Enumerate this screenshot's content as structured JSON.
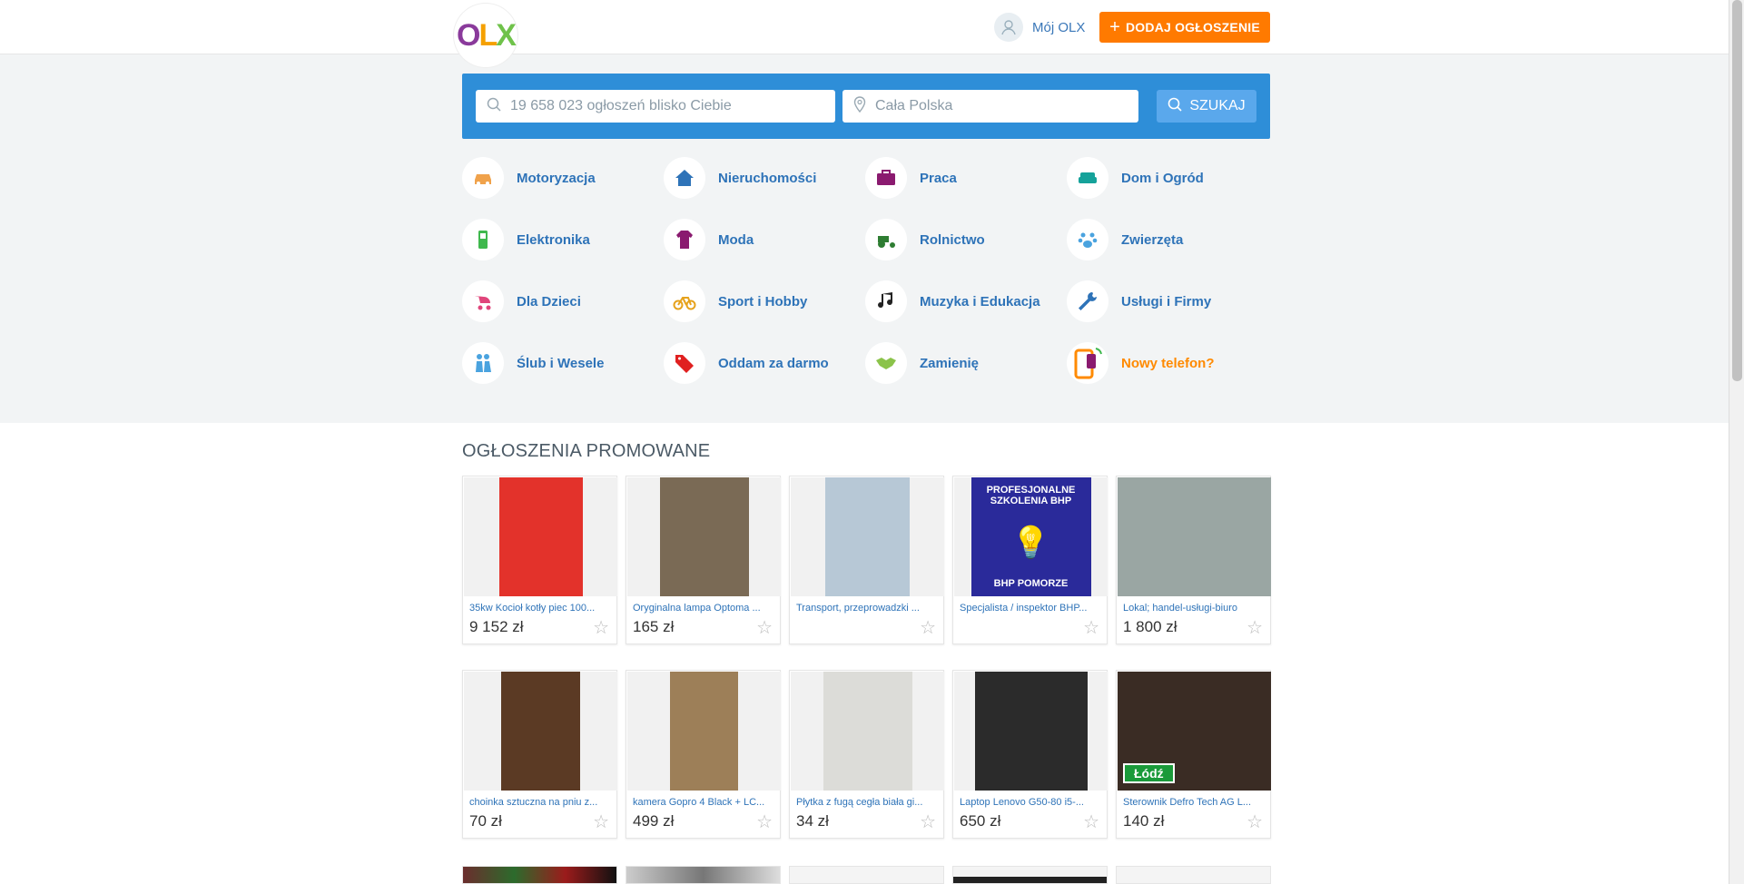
{
  "header": {
    "logo_letters": [
      "O",
      "L",
      "X"
    ],
    "my_olx": "Mój OLX",
    "add_ad": "DODAJ OGŁOSZENIE"
  },
  "search": {
    "query_placeholder": "19 658 023 ogłoszeń blisko Ciebie",
    "location_placeholder": "Cała Polska",
    "button": "SZUKAJ"
  },
  "categories": [
    {
      "label": "Motoryzacja",
      "icon": "car-icon",
      "color": "#f0a24b"
    },
    {
      "label": "Nieruchomości",
      "icon": "house-icon",
      "color": "#2e73b8"
    },
    {
      "label": "Praca",
      "icon": "briefcase-icon",
      "color": "#8a1a6f"
    },
    {
      "label": "Dom i Ogród",
      "icon": "sofa-icon",
      "color": "#15a29a"
    },
    {
      "label": "Elektronika",
      "icon": "phone-icon",
      "color": "#3fb84d"
    },
    {
      "label": "Moda",
      "icon": "jacket-icon",
      "color": "#8a1a6f"
    },
    {
      "label": "Rolnictwo",
      "icon": "tractor-icon",
      "color": "#2e7d32"
    },
    {
      "label": "Zwierzęta",
      "icon": "paw-icon",
      "color": "#4aa3df"
    },
    {
      "label": "Dla Dzieci",
      "icon": "stroller-icon",
      "color": "#e0457b"
    },
    {
      "label": "Sport i Hobby",
      "icon": "bike-icon",
      "color": "#e6a21c"
    },
    {
      "label": "Muzyka i Edukacja",
      "icon": "music-icon",
      "color": "#222222"
    },
    {
      "label": "Usługi i Firmy",
      "icon": "wrench-icon",
      "color": "#2e73b8"
    },
    {
      "label": "Ślub i Wesele",
      "icon": "couple-icon",
      "color": "#4aa3df"
    },
    {
      "label": "Oddam za darmo",
      "icon": "tag-icon",
      "color": "#e02020"
    },
    {
      "label": "Zamienię",
      "icon": "handshake-icon",
      "color": "#8bc34a"
    },
    {
      "label": "Nowy telefon?",
      "icon": "new-phone-icon",
      "color": "#ff8a00"
    }
  ],
  "promoted": {
    "title": "OGŁOSZENIA PROMOWANE",
    "items": [
      {
        "title": "35kw Kocioł kotły piec 100...",
        "price": "9 152 zł",
        "thumb": "#e3322b",
        "thumb_w": 92
      },
      {
        "title": "Oryginalna lampa Optoma ...",
        "price": "165 zł",
        "thumb": "#7a6a55",
        "thumb_w": 98
      },
      {
        "title": "Transport, przeprowadzki ...",
        "price": "",
        "thumb": "#b7c8d6",
        "thumb_w": 93
      },
      {
        "title": "Specjalista / inspektor BHP...",
        "price": "",
        "thumb": "#2a2a9a",
        "thumb_w": 132
      },
      {
        "title": "Lokal; handel-usługi-biuro",
        "price": "1 800 zł",
        "thumb": "#9aa6a3",
        "thumb_w": 169
      },
      {
        "title": "choinka sztuczna na pniu z...",
        "price": "70 zł",
        "thumb": "#5b3a24",
        "thumb_w": 87
      },
      {
        "title": "kamera Gopro 4 Black + LC...",
        "price": "499 zł",
        "thumb": "#9d7f58",
        "thumb_w": 75
      },
      {
        "title": "Płytka z fugą cegła biała gi...",
        "price": "34 zł",
        "thumb": "#dcdcd8",
        "thumb_w": 98
      },
      {
        "title": "Laptop Lenovo G50-80 i5-...",
        "price": "650 zł",
        "thumb": "#2b2b2b",
        "thumb_w": 124
      },
      {
        "title": "Sterownik Defro Tech AG L...",
        "price": "140 zł",
        "thumb": "#3a2c24",
        "thumb_w": 169
      }
    ],
    "thumb_badges": {
      "card_10": "Łódź",
      "card_4": "PROFESJONALNE SZKOLENIA BHP",
      "card_4_footer": "BHP POMORZE"
    }
  }
}
